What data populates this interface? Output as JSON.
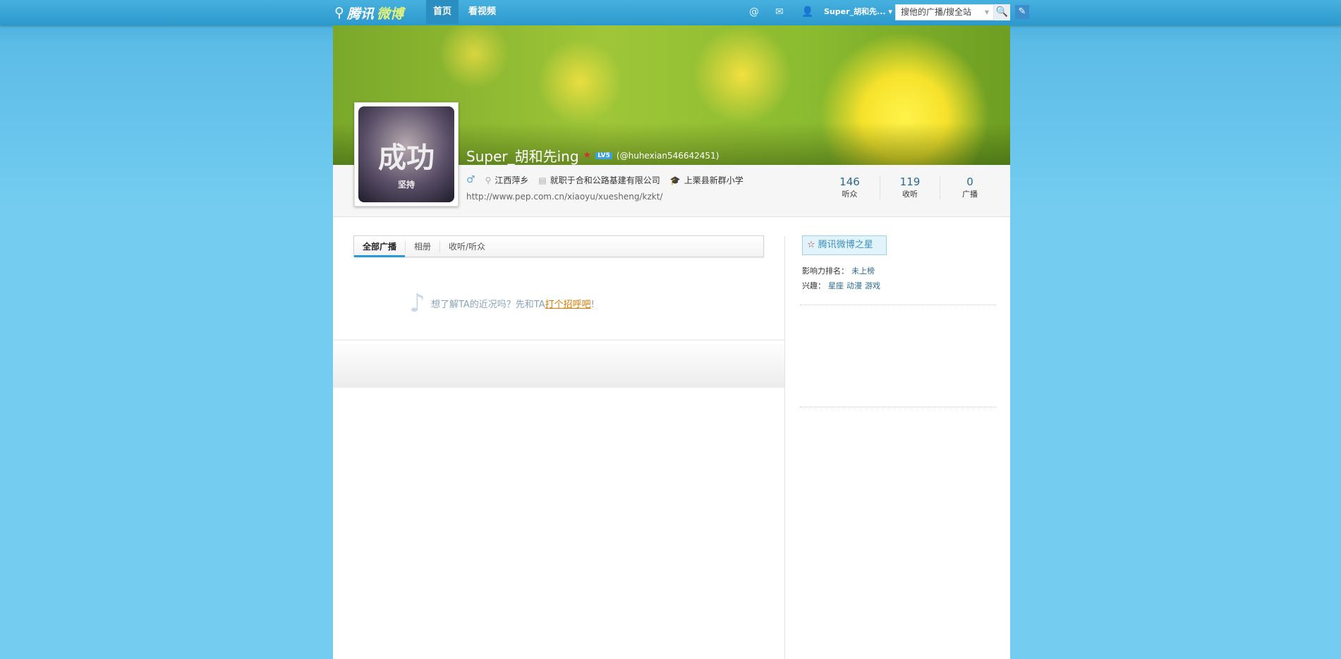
{
  "topbar": {
    "logo_a": "腾讯",
    "logo_b": "微博",
    "nav": [
      "首页",
      "看视频"
    ],
    "user": "Super_胡和先...",
    "search_placeholder": "搜他的广播/搜全站"
  },
  "profile": {
    "name": "Super_胡和先ing",
    "level": "LV5",
    "account": "(@huhexian546642451)",
    "gender": "♂",
    "location": "江西萍乡",
    "job": "就职于合和公路基建有限公司",
    "school": "上栗县新群小学",
    "url": "http://www.pep.com.cn/xiaoyu/xuesheng/kzkt/",
    "avatar_text": "成功",
    "avatar_sub": "坚持",
    "stats": [
      {
        "value": "146",
        "label": "听众"
      },
      {
        "value": "119",
        "label": "收听"
      },
      {
        "value": "0",
        "label": "广播"
      }
    ]
  },
  "tabs": [
    "全部广播",
    "相册",
    "收听/听众"
  ],
  "empty": {
    "text": "想了解TA的近况吗？先和TA",
    "link": "打个招呼吧",
    "end": "!"
  },
  "sidebar": {
    "star": "腾讯微博之星",
    "rank_label": "影响力排名：",
    "rank_value": "未上榜",
    "interest_label": "兴趣：",
    "interests": [
      "星座",
      "动漫",
      "游戏"
    ]
  }
}
